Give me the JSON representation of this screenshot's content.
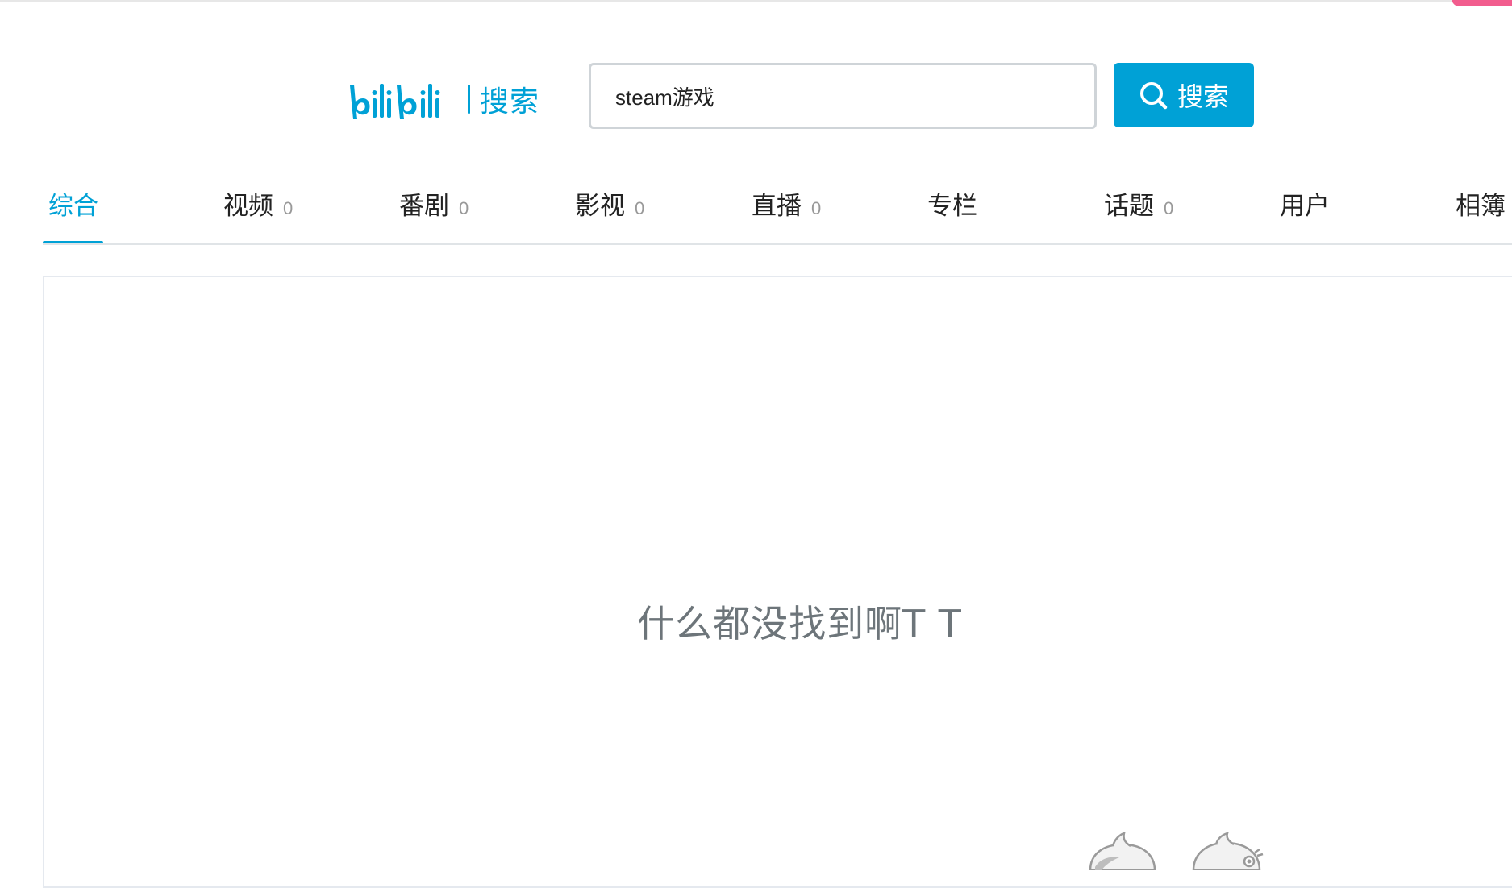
{
  "brand": {
    "logo_alt": "bilibili",
    "section_label": "搜索",
    "accent_color": "#00a1d6",
    "pink_color": "#f25d8e"
  },
  "search": {
    "value": "steam游戏",
    "button_label": "搜索",
    "button_icon": "search-icon"
  },
  "tabs": [
    {
      "label": "综合",
      "count": "",
      "active": true
    },
    {
      "label": "视频",
      "count": "0"
    },
    {
      "label": "番剧",
      "count": "0"
    },
    {
      "label": "影视",
      "count": "0"
    },
    {
      "label": "直播",
      "count": "0"
    },
    {
      "label": "专栏",
      "count": ""
    },
    {
      "label": "话题",
      "count": "0"
    },
    {
      "label": "用户",
      "count": ""
    },
    {
      "label": "相簿",
      "count": ""
    }
  ],
  "empty_state": {
    "message": "什么都没找到啊T T",
    "illustration": "two-mascots-peeking-icon"
  }
}
